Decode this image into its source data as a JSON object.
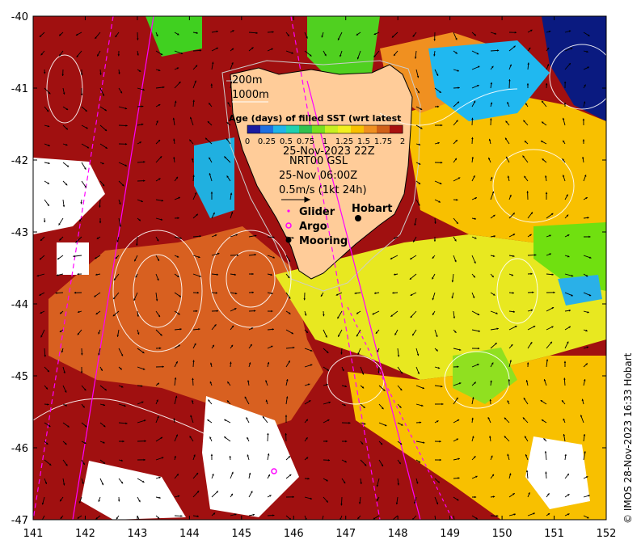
{
  "axes": {
    "x_ticks": [
      "141",
      "142",
      "143",
      "144",
      "145",
      "146",
      "147",
      "148",
      "149",
      "150",
      "151",
      "152"
    ],
    "y_ticks": [
      "-40",
      "-41",
      "-42",
      "-43",
      "-44",
      "-45",
      "-46",
      "-47"
    ],
    "lon_range": [
      141,
      152
    ],
    "lat_range": [
      -47,
      -40
    ]
  },
  "legend": {
    "contour_200": "200m",
    "contour_1000": "1000m",
    "colorbar_title": "Age (days) of filled SST (wrt latest",
    "colorbar_ticks": [
      "0",
      "0.25",
      "0.5",
      "0.75",
      "1",
      "1.25",
      "1.5",
      "1.75",
      "2"
    ],
    "colorbar_colors": [
      "#1a1aa0",
      "#1e6fe0",
      "#20b4e8",
      "#1fd0b0",
      "#32c050",
      "#7ae020",
      "#c8f020",
      "#f2f020",
      "#f8c000",
      "#f09020",
      "#d06018",
      "#a81010"
    ],
    "date_label": "25-Nov-2023 22Z",
    "source_label": "NRT00 GSL",
    "current_time": "25-Nov 06:00Z",
    "scale_label": "0.5m/s (1kt 24h)",
    "glider": "Glider",
    "argo": "Argo",
    "mooring": "Mooring"
  },
  "places": {
    "hobart": "Hobart"
  },
  "credit": "© IMOS 28-Nov-2023 16:33 Hobart",
  "colors": {
    "land": "#ffcc99",
    "ocean_age_2": "#a01010",
    "ocean_age_175": "#d86020",
    "ocean_age_15": "#f0a020",
    "ocean_age_125": "#f8c800",
    "ocean_age_1": "#e8f020",
    "ocean_age_075": "#80e010",
    "ocean_age_05": "#20c0f0",
    "ocean_age_0": "#002080",
    "glider_track": "#ff00ff",
    "argo": "#ff00ff"
  }
}
